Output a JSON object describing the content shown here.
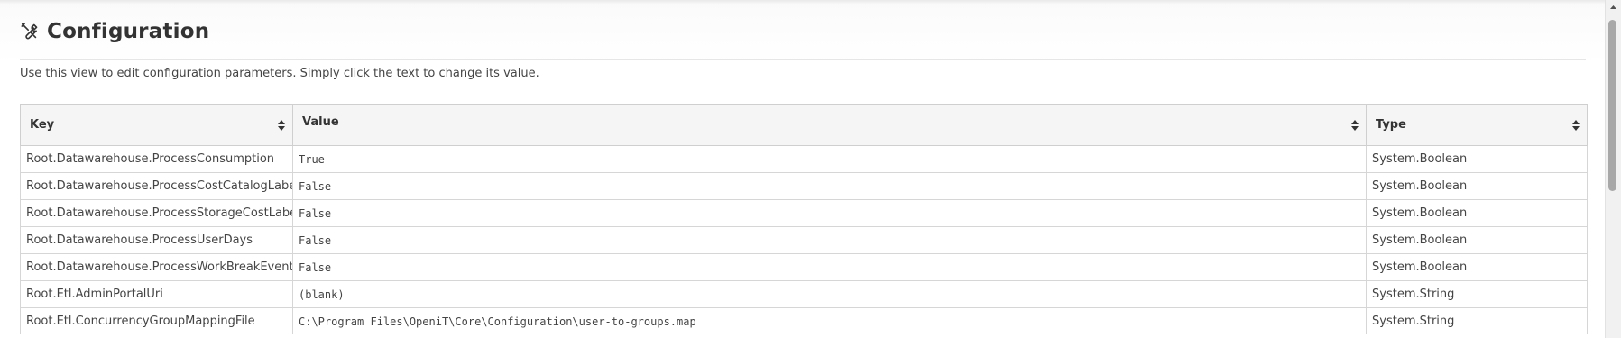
{
  "header": {
    "icon": "tools-icon",
    "title": "Configuration"
  },
  "description": "Use this view to edit configuration parameters. Simply click the text to change its value.",
  "table": {
    "columns": [
      {
        "label": "Key",
        "icon": "sort-icon"
      },
      {
        "label": "Value",
        "icon": "sort-icon"
      },
      {
        "label": "Type",
        "icon": "sort-icon"
      }
    ],
    "rows": [
      {
        "key": "Root.Datawarehouse.ProcessConsumption",
        "value": "True",
        "type": "System.Boolean"
      },
      {
        "key": "Root.Datawarehouse.ProcessCostCatalogLabel",
        "value": "False",
        "type": "System.Boolean"
      },
      {
        "key": "Root.Datawarehouse.ProcessStorageCostLabel",
        "value": "False",
        "type": "System.Boolean"
      },
      {
        "key": "Root.Datawarehouse.ProcessUserDays",
        "value": "False",
        "type": "System.Boolean"
      },
      {
        "key": "Root.Datawarehouse.ProcessWorkBreakEvent",
        "value": "False",
        "type": "System.Boolean"
      },
      {
        "key": "Root.Etl.AdminPortalUri",
        "value": "(blank)",
        "type": "System.String"
      },
      {
        "key": "Root.Etl.ConcurrencyGroupMappingFile",
        "value": "C:\\Program Files\\OpeniT\\Core\\Configuration\\user-to-groups.map",
        "type": "System.String"
      }
    ]
  }
}
